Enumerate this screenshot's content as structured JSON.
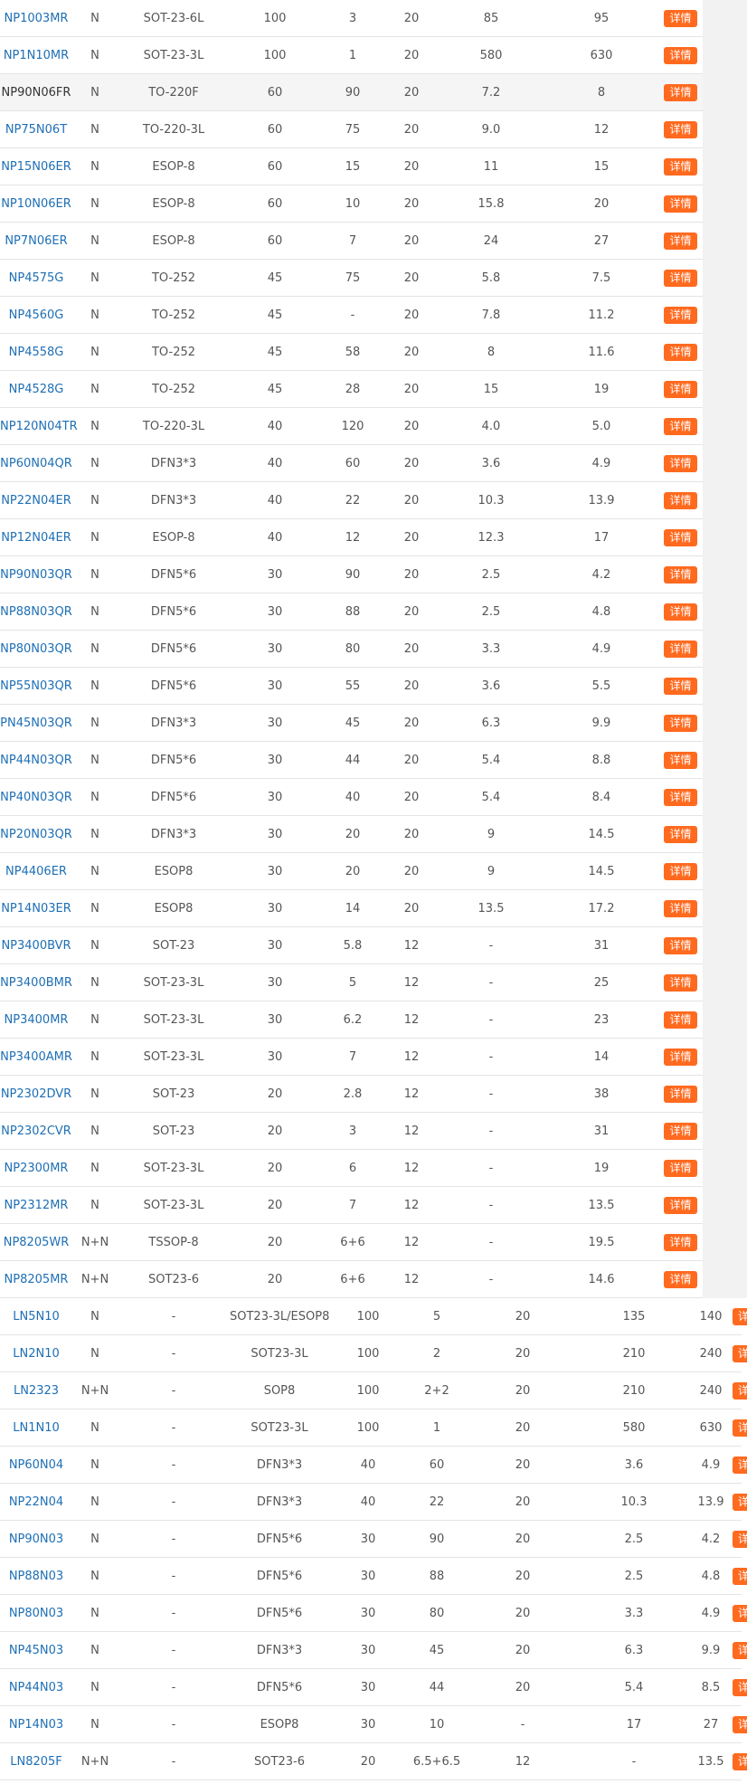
{
  "button_label": "详情",
  "colors": {
    "link": "#1e6fb5",
    "button": "#ff6a1f",
    "border": "#e4e4e4"
  },
  "highlight_model": "NP90N06FR",
  "table_a": [
    [
      "NP1003MR",
      "N",
      "SOT-23-6L",
      "100",
      "3",
      "20",
      "85",
      "95"
    ],
    [
      "NP1N10MR",
      "N",
      "SOT-23-3L",
      "100",
      "1",
      "20",
      "580",
      "630"
    ],
    [
      "NP90N06FR",
      "N",
      "TO-220F",
      "60",
      "90",
      "20",
      "7.2",
      "8"
    ],
    [
      "NP75N06T",
      "N",
      "TO-220-3L",
      "60",
      "75",
      "20",
      "9.0",
      "12"
    ],
    [
      "NP15N06ER",
      "N",
      "ESOP-8",
      "60",
      "15",
      "20",
      "11",
      "15"
    ],
    [
      "NP10N06ER",
      "N",
      "ESOP-8",
      "60",
      "10",
      "20",
      "15.8",
      "20"
    ],
    [
      "NP7N06ER",
      "N",
      "ESOP-8",
      "60",
      "7",
      "20",
      "24",
      "27"
    ],
    [
      "NP4575G",
      "N",
      "TO-252",
      "45",
      "75",
      "20",
      "5.8",
      "7.5"
    ],
    [
      "NP4560G",
      "N",
      "TO-252",
      "45",
      "-",
      "20",
      "7.8",
      "11.2"
    ],
    [
      "NP4558G",
      "N",
      "TO-252",
      "45",
      "58",
      "20",
      "8",
      "11.6"
    ],
    [
      "NP4528G",
      "N",
      "TO-252",
      "45",
      "28",
      "20",
      "15",
      "19"
    ],
    [
      "NP120N04TR",
      "N",
      "TO-220-3L",
      "40",
      "120",
      "20",
      "4.0",
      "5.0"
    ],
    [
      "NP60N04QR",
      "N",
      "DFN3*3",
      "40",
      "60",
      "20",
      "3.6",
      "4.9"
    ],
    [
      "NP22N04ER",
      "N",
      "DFN3*3",
      "40",
      "22",
      "20",
      "10.3",
      "13.9"
    ],
    [
      "NP12N04ER",
      "N",
      "ESOP-8",
      "40",
      "12",
      "20",
      "12.3",
      "17"
    ],
    [
      "NP90N03QR",
      "N",
      "DFN5*6",
      "30",
      "90",
      "20",
      "2.5",
      "4.2"
    ],
    [
      "NP88N03QR",
      "N",
      "DFN5*6",
      "30",
      "88",
      "20",
      "2.5",
      "4.8"
    ],
    [
      "NP80N03QR",
      "N",
      "DFN5*6",
      "30",
      "80",
      "20",
      "3.3",
      "4.9"
    ],
    [
      "NP55N03QR",
      "N",
      "DFN5*6",
      "30",
      "55",
      "20",
      "3.6",
      "5.5"
    ],
    [
      "PN45N03QR",
      "N",
      "DFN3*3",
      "30",
      "45",
      "20",
      "6.3",
      "9.9"
    ],
    [
      "NP44N03QR",
      "N",
      "DFN5*6",
      "30",
      "44",
      "20",
      "5.4",
      "8.8"
    ],
    [
      "NP40N03QR",
      "N",
      "DFN5*6",
      "30",
      "40",
      "20",
      "5.4",
      "8.4"
    ],
    [
      "NP20N03QR",
      "N",
      "DFN3*3",
      "30",
      "20",
      "20",
      "9",
      "14.5"
    ],
    [
      "NP4406ER",
      "N",
      "ESOP8",
      "30",
      "20",
      "20",
      "9",
      "14.5"
    ],
    [
      "NP14N03ER",
      "N",
      "ESOP8",
      "30",
      "14",
      "20",
      "13.5",
      "17.2"
    ],
    [
      "NP3400BVR",
      "N",
      "SOT-23",
      "30",
      "5.8",
      "12",
      "-",
      "31"
    ],
    [
      "NP3400BMR",
      "N",
      "SOT-23-3L",
      "30",
      "5",
      "12",
      "-",
      "25"
    ],
    [
      "NP3400MR",
      "N",
      "SOT-23-3L",
      "30",
      "6.2",
      "12",
      "-",
      "23"
    ],
    [
      "NP3400AMR",
      "N",
      "SOT-23-3L",
      "30",
      "7",
      "12",
      "-",
      "14"
    ],
    [
      "NP2302DVR",
      "N",
      "SOT-23",
      "20",
      "2.8",
      "12",
      "-",
      "38"
    ],
    [
      "NP2302CVR",
      "N",
      "SOT-23",
      "20",
      "3",
      "12",
      "-",
      "31"
    ],
    [
      "NP2300MR",
      "N",
      "SOT-23-3L",
      "20",
      "6",
      "12",
      "-",
      "19"
    ],
    [
      "NP2312MR",
      "N",
      "SOT-23-3L",
      "20",
      "7",
      "12",
      "-",
      "13.5"
    ],
    [
      "NP8205WR",
      "N+N",
      "TSSOP-8",
      "20",
      "6+6",
      "12",
      "-",
      "19.5"
    ],
    [
      "NP8205MR",
      "N+N",
      "SOT23-6",
      "20",
      "6+6",
      "12",
      "-",
      "14.6"
    ]
  ],
  "table_b": [
    [
      "LN5N10",
      "N",
      "-",
      "SOT23-3L/ESOP8",
      "100",
      "5",
      "20",
      "135",
      "140"
    ],
    [
      "LN2N10",
      "N",
      "-",
      "SOT23-3L",
      "100",
      "2",
      "20",
      "210",
      "240"
    ],
    [
      "LN2323",
      "N+N",
      "-",
      "SOP8",
      "100",
      "2+2",
      "20",
      "210",
      "240"
    ],
    [
      "LN1N10",
      "N",
      "-",
      "SOT23-3L",
      "100",
      "1",
      "20",
      "580",
      "630"
    ],
    [
      "NP60N04",
      "N",
      "-",
      "DFN3*3",
      "40",
      "60",
      "20",
      "3.6",
      "4.9"
    ],
    [
      "NP22N04",
      "N",
      "-",
      "DFN3*3",
      "40",
      "22",
      "20",
      "10.3",
      "13.9"
    ],
    [
      "NP90N03",
      "N",
      "-",
      "DFN5*6",
      "30",
      "90",
      "20",
      "2.5",
      "4.2"
    ],
    [
      "NP88N03",
      "N",
      "-",
      "DFN5*6",
      "30",
      "88",
      "20",
      "2.5",
      "4.8"
    ],
    [
      "NP80N03",
      "N",
      "-",
      "DFN5*6",
      "30",
      "80",
      "20",
      "3.3",
      "4.9"
    ],
    [
      "NP45N03",
      "N",
      "-",
      "DFN3*3",
      "30",
      "45",
      "20",
      "6.3",
      "9.9"
    ],
    [
      "NP44N03",
      "N",
      "-",
      "DFN5*6",
      "30",
      "44",
      "20",
      "5.4",
      "8.5"
    ],
    [
      "NP14N03",
      "N",
      "-",
      "ESOP8",
      "30",
      "10",
      "-",
      "17",
      "27"
    ],
    [
      "LN8205F",
      "N+N",
      "-",
      "SOT23-6",
      "20",
      "6.5+6.5",
      "12",
      "-",
      "13.5"
    ]
  ]
}
